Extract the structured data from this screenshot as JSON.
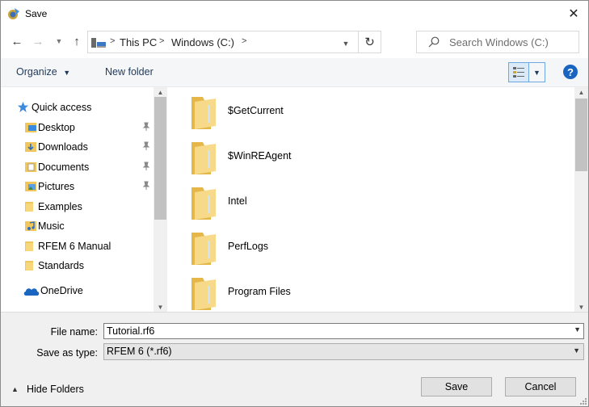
{
  "window": {
    "title": "Save"
  },
  "address": {
    "crumbs": [
      "This PC",
      "Windows (C:)"
    ],
    "separator": ">",
    "refresh_icon": "refresh-icon"
  },
  "search": {
    "placeholder": "Search Windows (C:)"
  },
  "commandbar": {
    "organize": "Organize",
    "new_folder": "New folder",
    "help": "?"
  },
  "navpane": {
    "quick_access": "Quick access",
    "items": [
      {
        "label": "Desktop",
        "icon": "desktop-folder-icon",
        "pinned": true
      },
      {
        "label": "Downloads",
        "icon": "downloads-folder-icon",
        "pinned": true
      },
      {
        "label": "Documents",
        "icon": "documents-folder-icon",
        "pinned": true
      },
      {
        "label": "Pictures",
        "icon": "pictures-folder-icon",
        "pinned": true
      },
      {
        "label": "Examples",
        "icon": "folder-icon",
        "pinned": false
      },
      {
        "label": "Music",
        "icon": "music-folder-icon",
        "pinned": false
      },
      {
        "label": "RFEM 6 Manual",
        "icon": "folder-icon",
        "pinned": false
      },
      {
        "label": "Standards",
        "icon": "folder-icon",
        "pinned": false
      }
    ],
    "onedrive": "OneDrive"
  },
  "files": [
    {
      "name": "$GetCurrent"
    },
    {
      "name": "$WinREAgent"
    },
    {
      "name": "Intel"
    },
    {
      "name": "PerfLogs"
    },
    {
      "name": "Program Files"
    }
  ],
  "form": {
    "file_name_label": "File name:",
    "file_name_value": "Tutorial.rf6",
    "save_type_label": "Save as type:",
    "save_type_value": "RFEM 6 (*.rf6)"
  },
  "footer": {
    "hide_folders": "Hide Folders",
    "save": "Save",
    "cancel": "Cancel"
  },
  "colors": {
    "accent": "#1a65c0",
    "folder": "#f0c75e",
    "commandbar_text": "#1e395b"
  }
}
